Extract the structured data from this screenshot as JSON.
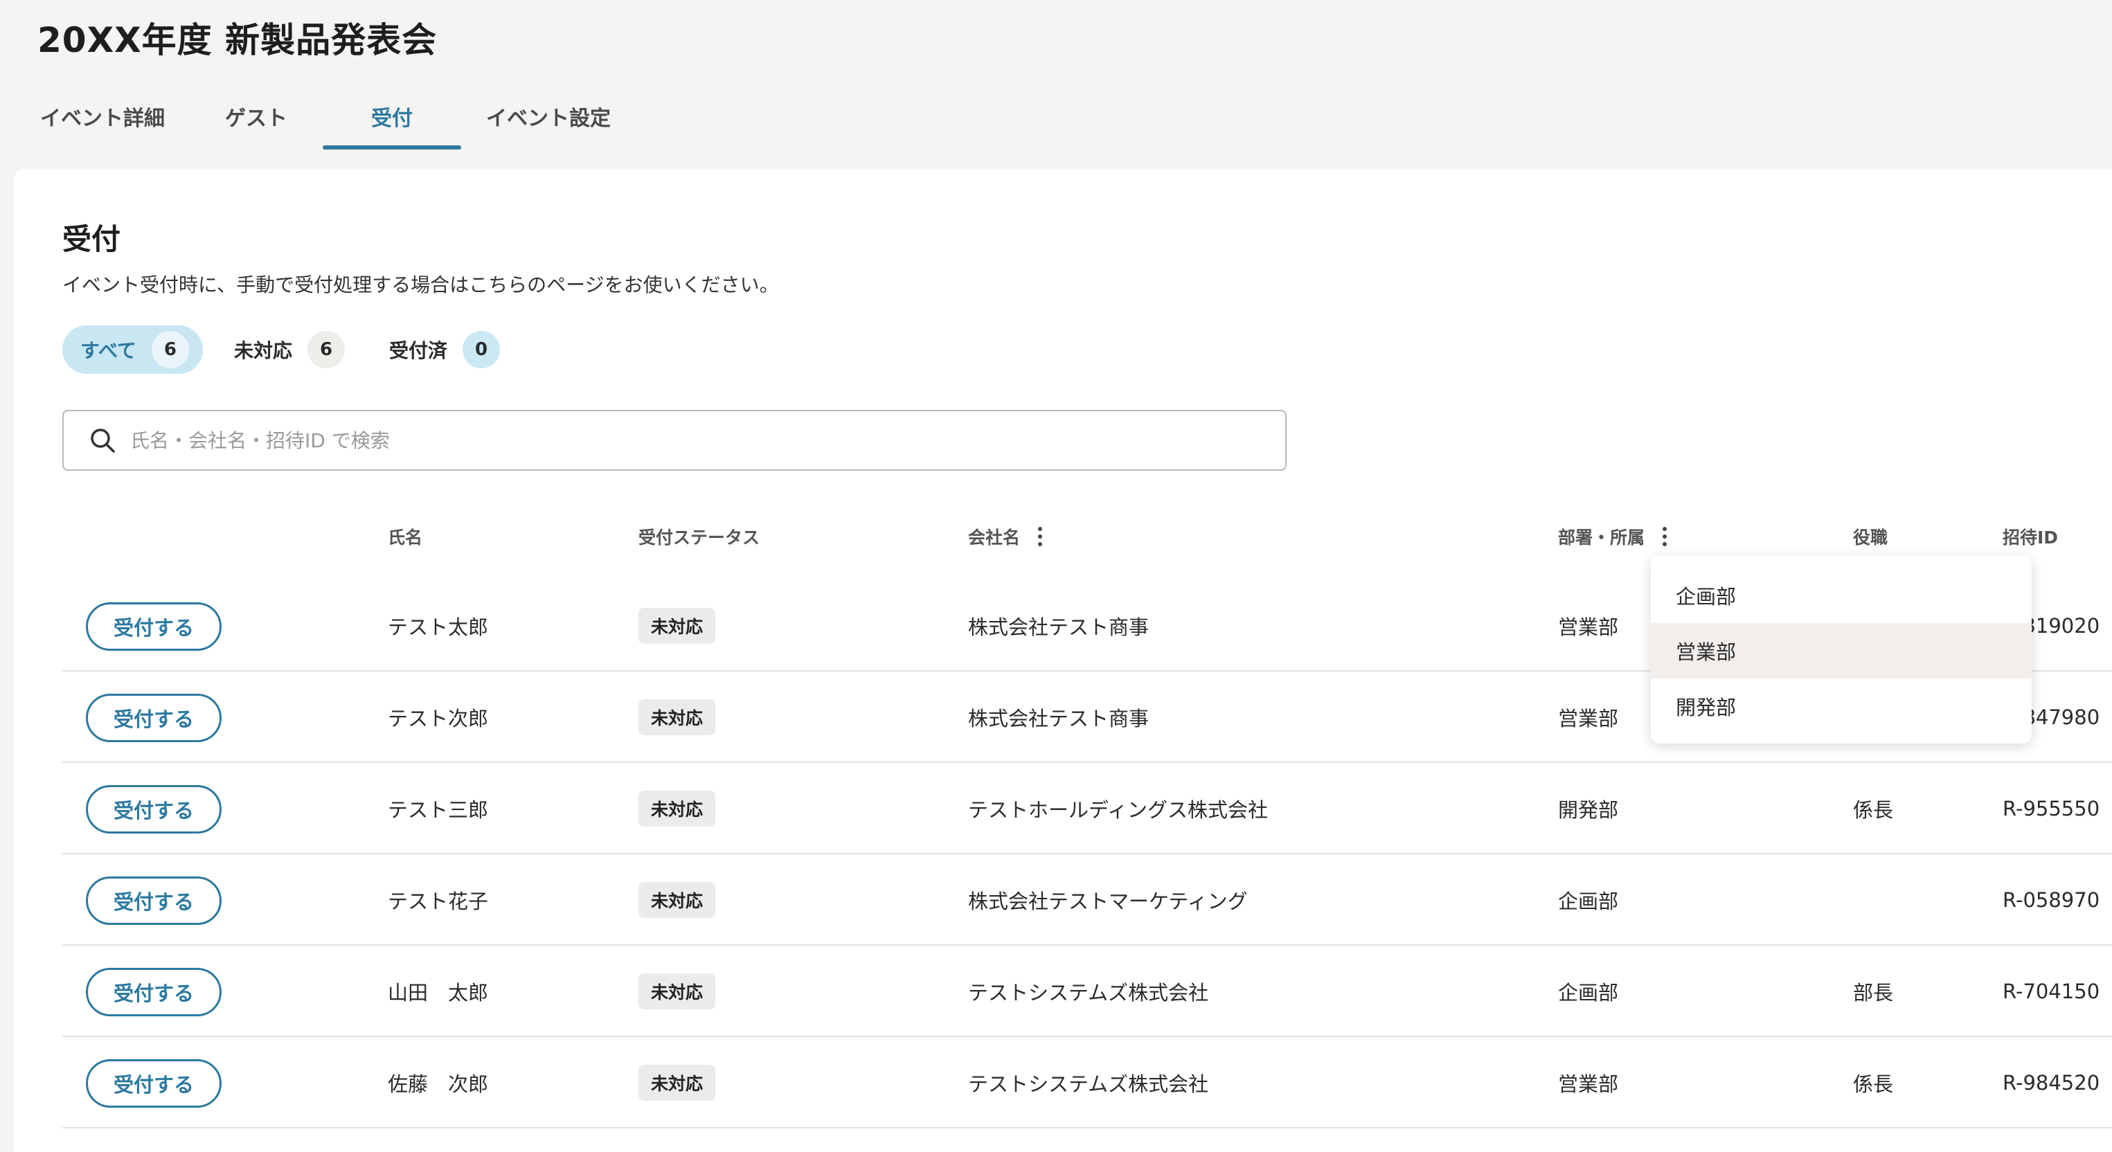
{
  "page_title": "20XX年度 新製品発表会",
  "tabs": [
    {
      "label": "イベント詳細"
    },
    {
      "label": "ゲスト"
    },
    {
      "label": "受付",
      "active": true
    },
    {
      "label": "イベント設定"
    }
  ],
  "section": {
    "title": "受付",
    "description": "イベント受付時に、手動で受付処理する場合はこちらのページをお使いください。"
  },
  "filters": [
    {
      "label": "すべて",
      "count": "6",
      "active": true
    },
    {
      "label": "未対応",
      "count": "6"
    },
    {
      "label": "受付済",
      "count": "0"
    }
  ],
  "search": {
    "placeholder": "氏名・会社名・招待ID で検索",
    "value": ""
  },
  "table": {
    "headers": {
      "name": "氏名",
      "status": "受付ステータス",
      "company": "会社名",
      "department": "部署・所属",
      "position": "役職",
      "invite_id": "招待ID"
    },
    "action_label": "受付する",
    "rows": [
      {
        "name": "テスト太郎",
        "status": "未対応",
        "company": "株式会社テスト商事",
        "department": "営業部",
        "position": "",
        "invite_id": "R-319020"
      },
      {
        "name": "テスト次郎",
        "status": "未対応",
        "company": "株式会社テスト商事",
        "department": "営業部",
        "position": "",
        "invite_id": "R-847980"
      },
      {
        "name": "テスト三郎",
        "status": "未対応",
        "company": "テストホールディングス株式会社",
        "department": "開発部",
        "position": "係長",
        "invite_id": "R-955550"
      },
      {
        "name": "テスト花子",
        "status": "未対応",
        "company": "株式会社テストマーケティング",
        "department": "企画部",
        "position": "",
        "invite_id": "R-058970"
      },
      {
        "name": "山田　太郎",
        "status": "未対応",
        "company": "テストシステムズ株式会社",
        "department": "企画部",
        "position": "部長",
        "invite_id": "R-704150"
      },
      {
        "name": "佐藤　次郎",
        "status": "未対応",
        "company": "テストシステムズ株式会社",
        "department": "営業部",
        "position": "係長",
        "invite_id": "R-984520"
      }
    ]
  },
  "department_dropdown": {
    "options": [
      "企画部",
      "営業部",
      "開発部"
    ],
    "hovered": "営業部"
  },
  "colors": {
    "accent": "#2c79a0",
    "filter_active_bg": "#c9e6f3",
    "badge_bg": "#ecebe9",
    "page_bg": "#f5f4f2"
  },
  "icons": {
    "search": "search-icon",
    "column_menu": "more-vertical-icon"
  }
}
